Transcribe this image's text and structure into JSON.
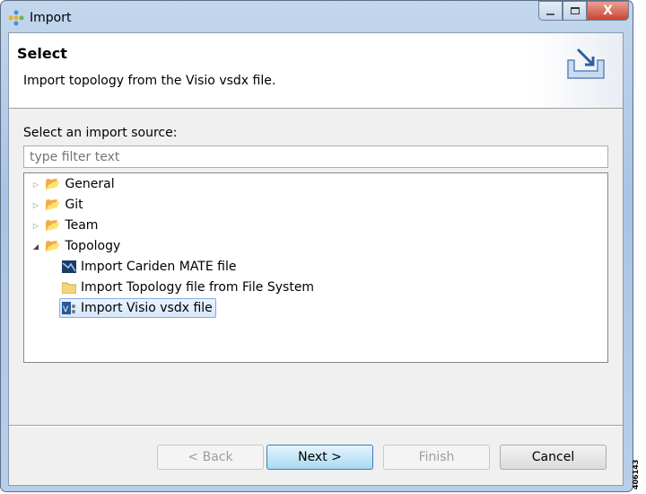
{
  "window": {
    "title": "Import",
    "close_glyph": "X"
  },
  "header": {
    "title": "Select",
    "description": "Import topology from the Visio vsdx file."
  },
  "source_label": "Select an import source:",
  "filter": {
    "placeholder": "type filter text",
    "value": ""
  },
  "tree": [
    {
      "label": "General",
      "expanded": false,
      "icon": "folder-icon"
    },
    {
      "label": "Git",
      "expanded": false,
      "icon": "folder-icon"
    },
    {
      "label": "Team",
      "expanded": false,
      "icon": "folder-icon"
    },
    {
      "label": "Topology",
      "expanded": true,
      "icon": "folder-icon"
    },
    {
      "label": "Import Cariden MATE file",
      "icon": "cariden-icon"
    },
    {
      "label": "Import Topology file from File System",
      "icon": "folder-file-icon"
    },
    {
      "label": "Import Visio vsdx file",
      "icon": "visio-icon",
      "selected": true
    }
  ],
  "buttons": {
    "back": "< Back",
    "next": "Next >",
    "finish": "Finish",
    "cancel": "Cancel"
  },
  "figure_id": "406143"
}
